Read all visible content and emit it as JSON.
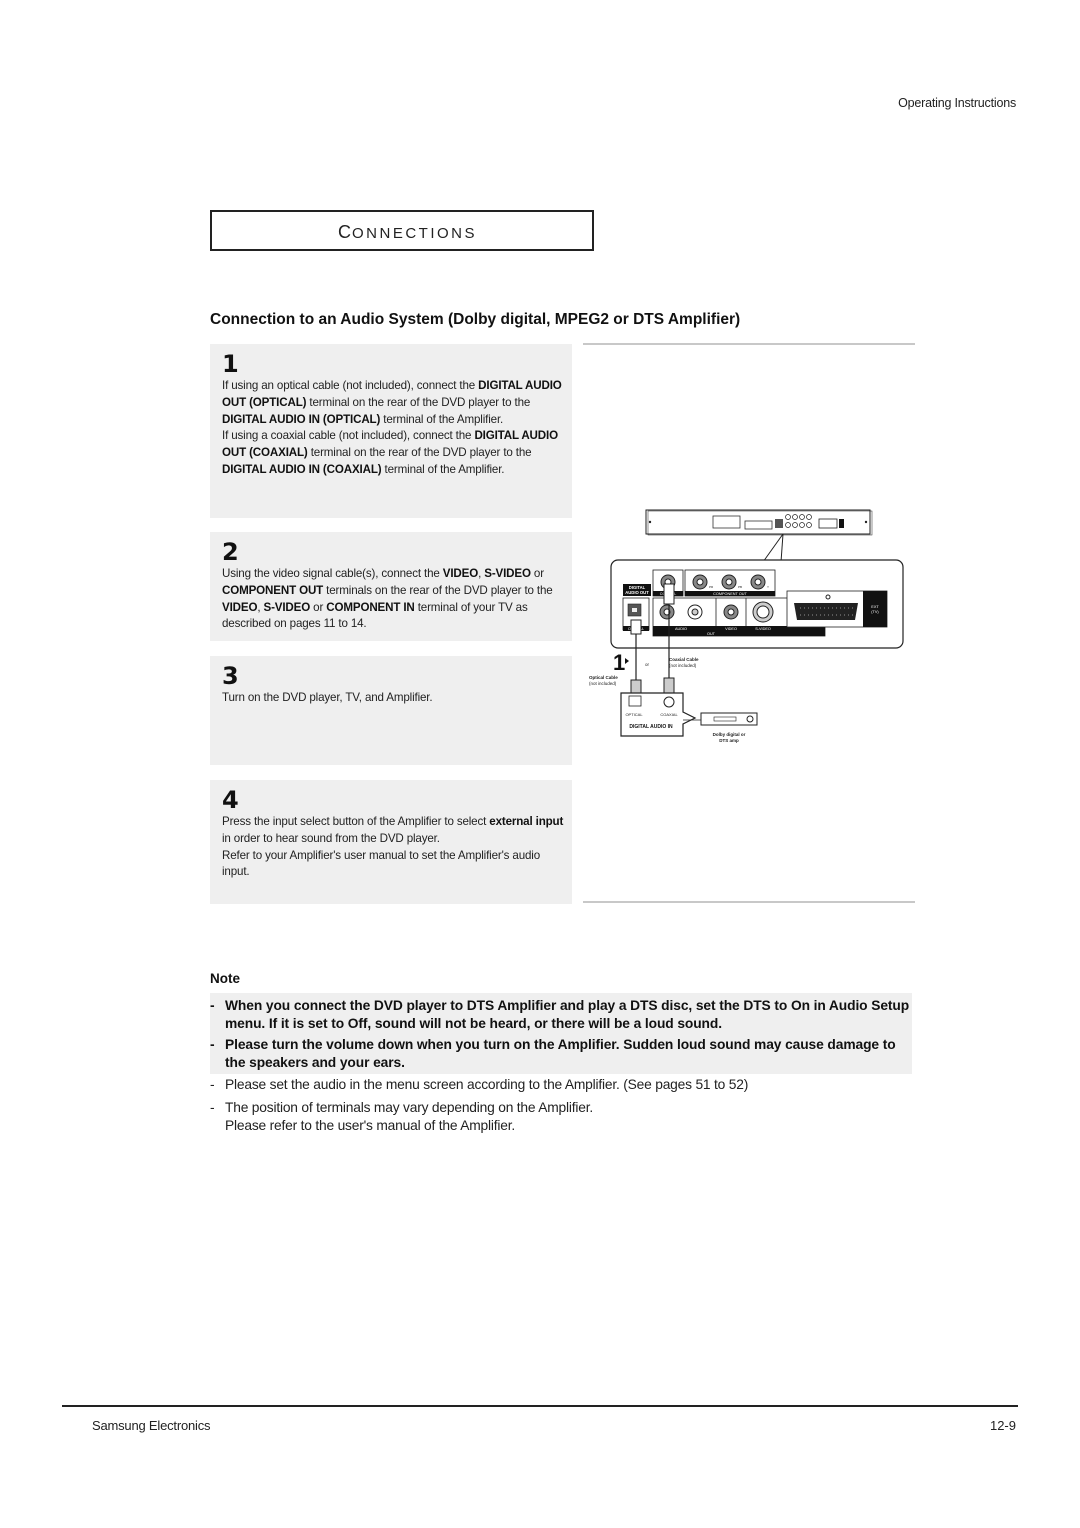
{
  "header": {
    "section_label": "Operating Instructions"
  },
  "section": {
    "title_first": "C",
    "title_rest": "ONNECTIONS"
  },
  "heading": "Connection to an Audio System (Dolby digital, MPEG2 or DTS Amplifier)",
  "steps": [
    {
      "number": "1",
      "parts": [
        {
          "t": "If using an optical cable (not included), connect the ",
          "b": false
        },
        {
          "t": "DIGITAL AUDIO OUT (OPTICAL)",
          "b": true
        },
        {
          "t": " terminal on the rear of the DVD player to the ",
          "b": false
        },
        {
          "t": "DIGITAL AUDIO IN (OPTICAL)",
          "b": true
        },
        {
          "t": " terminal of the Amplifier.",
          "b": false
        },
        {
          "br": true
        },
        {
          "t": "If using a coaxial cable (not included), connect the ",
          "b": false
        },
        {
          "t": "DIGITAL AUDIO OUT (COAXIAL)",
          "b": true
        },
        {
          "t": " terminal on the rear of the DVD player to the ",
          "b": false
        },
        {
          "t": "DIGITAL AUDIO IN (COAXIAL)",
          "b": true
        },
        {
          "t": " terminal of the Amplifier.",
          "b": false
        }
      ]
    },
    {
      "number": "2",
      "parts": [
        {
          "t": "Using the video signal cable(s), connect the ",
          "b": false
        },
        {
          "t": "VIDEO",
          "b": true
        },
        {
          "t": ", ",
          "b": false
        },
        {
          "t": "S-VIDEO",
          "b": true
        },
        {
          "t": " or ",
          "b": false
        },
        {
          "t": "COMPONENT OUT",
          "b": true
        },
        {
          "t": " terminals on the rear of the DVD player to the ",
          "b": false
        },
        {
          "t": "VIDEO",
          "b": true
        },
        {
          "t": ", ",
          "b": false
        },
        {
          "t": "S-VIDEO",
          "b": true
        },
        {
          "t": " or ",
          "b": false
        },
        {
          "t": "COMPONENT IN",
          "b": true
        },
        {
          "t": " terminal of your TV as described on pages 11 to 14.",
          "b": false
        }
      ]
    },
    {
      "number": "3",
      "parts": [
        {
          "t": "Turn on the DVD player, TV, and Amplifier.",
          "b": false
        }
      ]
    },
    {
      "number": "4",
      "parts": [
        {
          "t": "Press the input select button of the Amplifier to select ",
          "b": false
        },
        {
          "t": "external input",
          "b": true
        },
        {
          "t": " in order to hear sound from the DVD player.",
          "b": false
        },
        {
          "br": true
        },
        {
          "t": "Refer to your Amplifier's user manual to set the Amplifier's audio input.",
          "b": false
        }
      ]
    }
  ],
  "diagram": {
    "labels": {
      "digital_audio_out": [
        "DIGITAL",
        "AUDIO OUT"
      ],
      "coaxial": "COAXIAL",
      "optical": "OPTICAL",
      "component_out": "COMPONENT OUT",
      "audio": "AUDIO",
      "video": "VIDEO",
      "s_video": "S-VIDEO",
      "out": "OUT",
      "ext_tv": [
        "EXT",
        "(TV)"
      ],
      "step_marker": "1",
      "or": "or",
      "optical_cable": [
        "Optical Cable",
        "(not included)"
      ],
      "coaxial_cable": [
        "Coaxial Cable",
        "(not included)"
      ],
      "amp_optical": "OPTICAL",
      "amp_coaxial": "COAXIAL",
      "digital_audio_in": "DIGITAL AUDIO IN",
      "amp_caption": [
        "Dolby digital or",
        "DTS amp"
      ],
      "component_pins": [
        "PR",
        "PB",
        "Y"
      ],
      "audio_lr": [
        "L",
        "R"
      ]
    }
  },
  "note": {
    "label": "Note",
    "items": [
      {
        "text": "When you connect the DVD player to DTS Amplifier and play a DTS disc, set the DTS to On in Audio Setup menu. If it is set to Off, sound will not be heard, or there will be a loud sound.",
        "emphasis": true
      },
      {
        "text": "Please turn the volume down when you turn on the Amplifier. Sudden loud sound may cause damage to the speakers and your ears.",
        "emphasis": true
      },
      {
        "text": "Please set the audio in the menu screen according to the Amplifier. (See pages 51 to 52)",
        "emphasis": false
      },
      {
        "text": "The position of terminals may vary depending on the Amplifier.\nPlease refer to the user's manual of the Amplifier.",
        "emphasis": false
      }
    ],
    "dash": "-"
  },
  "footer": {
    "company": "Samsung Electronics",
    "page": "12-9"
  }
}
